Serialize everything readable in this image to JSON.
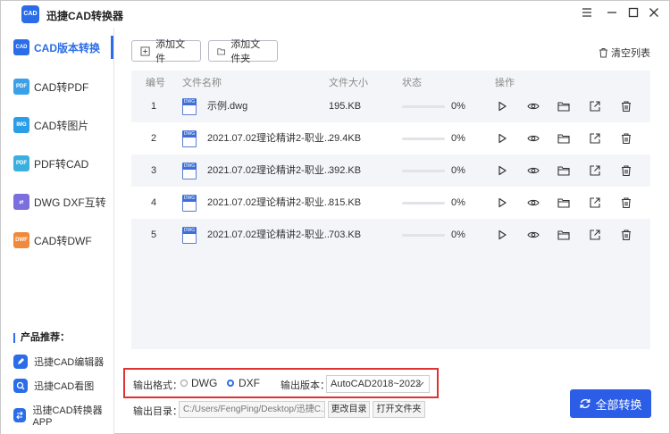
{
  "app": {
    "title": "迅捷CAD转换器",
    "logo_text": "CAD"
  },
  "window_controls": [
    "menu-icon",
    "minimize-icon",
    "maximize-icon",
    "close-icon"
  ],
  "sidebar": {
    "items": [
      {
        "label": "CAD版本转换",
        "icon": "cad-version-icon",
        "active": true,
        "color": "#2b6de8"
      },
      {
        "label": "CAD转PDF",
        "icon": "cad-to-pdf-icon",
        "color": "#3aa0e8"
      },
      {
        "label": "CAD转图片",
        "icon": "cad-to-image-icon",
        "color": "#2b9ee8"
      },
      {
        "label": "PDF转CAD",
        "icon": "pdf-to-cad-icon",
        "color": "#3ab0e0"
      },
      {
        "label": "DWG DXF互转",
        "icon": "dwg-dxf-icon",
        "color": "#7b6fe0"
      },
      {
        "label": "CAD转DWF",
        "icon": "cad-to-dwf-icon",
        "color": "#f08a3a"
      }
    ],
    "recommend_title": "产品推荐：",
    "recommend": [
      {
        "label": "迅捷CAD编辑器"
      },
      {
        "label": "迅捷CAD看图"
      },
      {
        "label": "迅捷CAD转换器APP"
      }
    ]
  },
  "toolbar": {
    "add_file": "添加文件",
    "add_folder": "添加文件夹",
    "clear_list": "清空列表"
  },
  "table": {
    "headers": {
      "index": "编号",
      "name": "文件名称",
      "size": "文件大小",
      "status": "状态",
      "actions": "操作"
    },
    "rows": [
      {
        "index": "1",
        "name": "示例.dwg",
        "size": "195.KB",
        "progress": "0%",
        "progress_value": 0
      },
      {
        "index": "2",
        "name": "2021.07.02理论精讲2-职业...",
        "size": "29.4KB",
        "progress": "0%",
        "progress_value": 0
      },
      {
        "index": "3",
        "name": "2021.07.02理论精讲2-职业...",
        "size": "392.KB",
        "progress": "0%",
        "progress_value": 0
      },
      {
        "index": "4",
        "name": "2021.07.02理论精讲2-职业...",
        "size": "815.KB",
        "progress": "0%",
        "progress_value": 0
      },
      {
        "index": "5",
        "name": "2021.07.02理论精讲2-职业...",
        "size": "703.KB",
        "progress": "0%",
        "progress_value": 0
      }
    ],
    "row_actions": [
      "play-icon",
      "preview-eye-icon",
      "open-folder-icon",
      "share-icon",
      "delete-icon"
    ]
  },
  "output": {
    "format_label": "输出格式：",
    "format_options": [
      "DWG",
      "DXF"
    ],
    "format_selected": "DXF",
    "version_label": "输出版本：",
    "version_value": "AutoCAD2018~2022",
    "dir_label": "输出目录：",
    "dir_value": "C:/Users/FengPing/Desktop/迅捷C...",
    "change_dir": "更改目录",
    "open_folder": "打开文件夹"
  },
  "convert_all": "全部转换",
  "colors": {
    "accent": "#2b6de8",
    "highlight_border": "#e03232",
    "convert_button": "#2c5de6"
  }
}
